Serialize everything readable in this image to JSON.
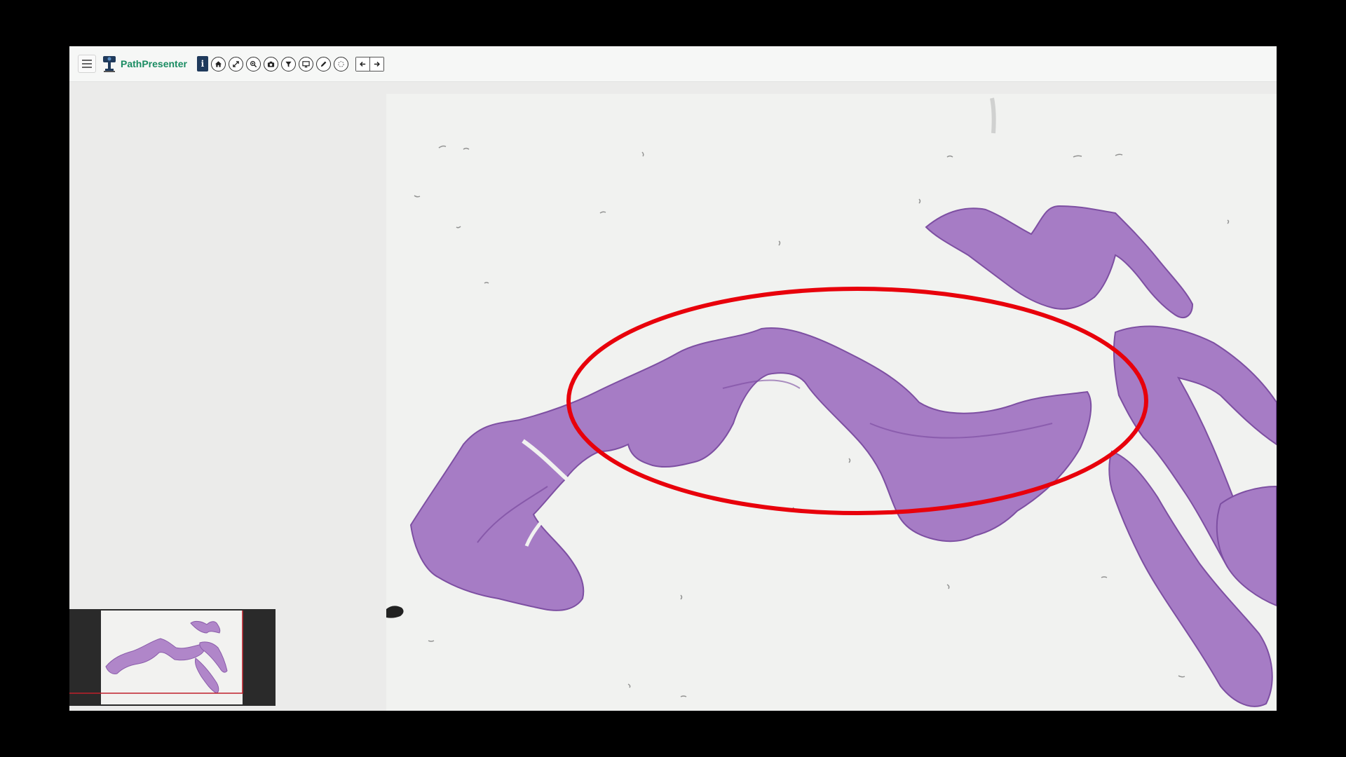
{
  "app": {
    "name": "PathPresenter",
    "menu_icon": "hamburger-icon",
    "logo_icon": "microscope-logo-icon"
  },
  "toolbar": {
    "info_label": "i",
    "tools": [
      {
        "name": "home-button",
        "icon": "home-icon"
      },
      {
        "name": "fullscreen-button",
        "icon": "expand-icon"
      },
      {
        "name": "zoom-button",
        "icon": "zoom-icon"
      },
      {
        "name": "snapshot-button",
        "icon": "camera-icon"
      },
      {
        "name": "filter-button",
        "icon": "filter-icon"
      },
      {
        "name": "present-button",
        "icon": "monitor-icon"
      },
      {
        "name": "annotate-button",
        "icon": "pencil-icon"
      },
      {
        "name": "rotate-button",
        "icon": "rotate-icon"
      }
    ],
    "nav": [
      {
        "name": "previous-slide-button",
        "icon": "arrow-left-icon"
      },
      {
        "name": "next-slide-button",
        "icon": "arrow-right-icon"
      }
    ]
  },
  "viewer": {
    "annotation_color": "#e8000b",
    "tissue_color": "#a577c4",
    "tissue_dark_color": "#7a4a9e",
    "background_color": "#f1f2f0"
  },
  "navigator": {
    "viewport_color": "#c0202a"
  }
}
